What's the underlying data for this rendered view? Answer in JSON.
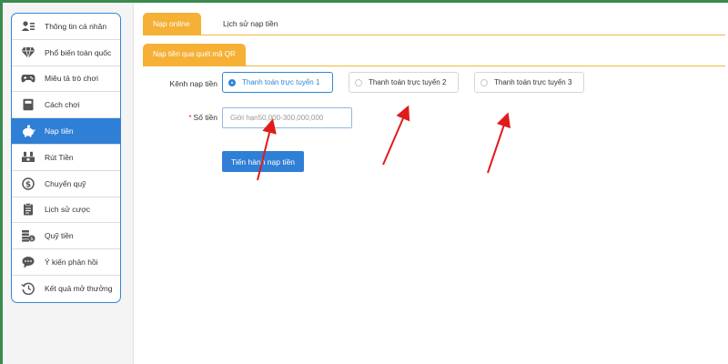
{
  "sidebar": {
    "items": [
      {
        "label": "Thông tin cá nhân",
        "icon": "user-card-icon"
      },
      {
        "label": "Phổ biến toàn quốc",
        "icon": "diamond-icon"
      },
      {
        "label": "Miêu tả trò chơi",
        "icon": "gamepad-icon"
      },
      {
        "label": "Cách chơi",
        "icon": "book-icon"
      },
      {
        "label": "Nạp tiền",
        "icon": "piggy-bank-icon",
        "active": true
      },
      {
        "label": "Rút Tiền",
        "icon": "withdraw-icon"
      },
      {
        "label": "Chuyển quỹ",
        "icon": "dollar-circle-icon"
      },
      {
        "label": "Lịch sử cược",
        "icon": "clipboard-icon"
      },
      {
        "label": "Quỹ tiền",
        "icon": "coins-icon"
      },
      {
        "label": "Ý kiến phản hồi",
        "icon": "chat-bubble-icon"
      },
      {
        "label": "Kết quả mở thưởng",
        "icon": "history-clock-icon"
      }
    ]
  },
  "tabs": {
    "online": "Nạp online",
    "history": "Lịch sử nạp tiền"
  },
  "subtab": "Nạp tiền qua quét mã QR",
  "form": {
    "channel_label": "Kênh nạp tiền",
    "channels": [
      {
        "label": "Thanh toán trực tuyến 1",
        "selected": true
      },
      {
        "label": "Thanh toán trực tuyến 2",
        "selected": false
      },
      {
        "label": "Thanh toán trực tuyến 3",
        "selected": false
      }
    ],
    "required_mark": "*",
    "amount_label": "Số tiền",
    "amount_placeholder": "Giới hạn50,000-300,000,000",
    "submit_label": "Tiến hành nạp tiền"
  },
  "colors": {
    "accent_orange": "#f5b035",
    "accent_blue": "#2f7fd6",
    "annotation_red": "#e01b1b",
    "frame_green": "#3a8a4e"
  }
}
